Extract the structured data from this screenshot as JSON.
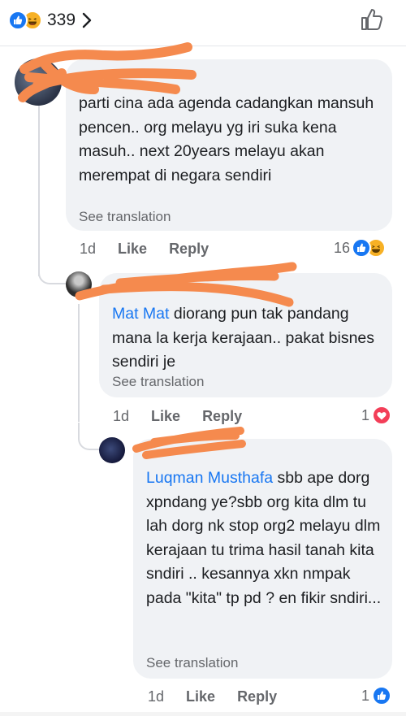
{
  "reactions_bar": {
    "count": "339",
    "icons": [
      "like-icon",
      "haha-icon"
    ]
  },
  "comments": [
    {
      "text": "parti cina ada agenda cadangkan mansuh pencen.. org melayu yg iri suka kena masuh.. next 20years melayu akan merempat di negara sendiri",
      "see_translation": "See translation",
      "time": "1d",
      "like_label": "Like",
      "reply_label": "Reply",
      "reaction_count": "16",
      "reaction_icons": [
        "like-icon",
        "haha-icon"
      ]
    },
    {
      "mention": "Mat Mat",
      "text": " diorang pun tak pandang mana la kerja kerajaan.. pakat bisnes sendiri je",
      "see_translation": "See translation",
      "time": "1d",
      "like_label": "Like",
      "reply_label": "Reply",
      "reaction_count": "1",
      "reaction_icons": [
        "love-icon"
      ]
    },
    {
      "mention": "Luqman Musthafa",
      "text": " sbb ape dorg xpndang ye?sbb org kita dlm tu lah dorg nk stop org2 melayu dlm kerajaan tu trima hasil tanah kita sndiri .. kesannya xkn nmpak  pada \"kita\" tp pd ? en fikir sndiri...",
      "see_translation": "See translation",
      "time": "1d",
      "like_label": "Like",
      "reply_label": "Reply",
      "reaction_count": "1",
      "reaction_icons": [
        "like-icon"
      ]
    }
  ],
  "colors": {
    "accent": "#1877f2",
    "bubble": "#f0f2f5",
    "scribble": "#f58a4e",
    "love": "#f33e58",
    "haha": "#f7b125"
  }
}
